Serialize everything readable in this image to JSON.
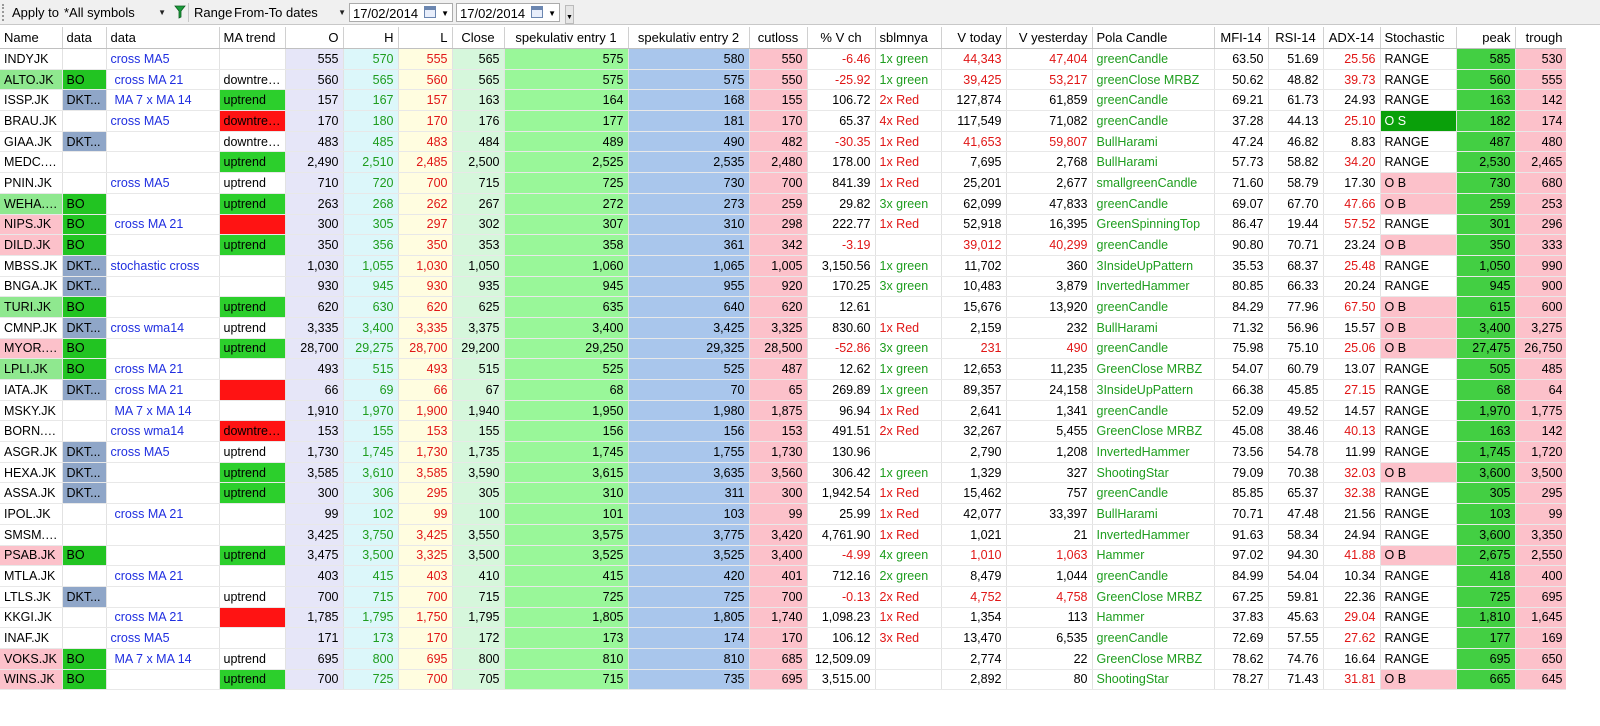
{
  "toolbar": {
    "apply_label": "Apply to",
    "apply_value": "*All symbols",
    "range_label": "Range",
    "range_value": "From-To dates",
    "date_from": "17/02/2014",
    "date_to": "17/02/2014"
  },
  "columns": [
    "Name",
    "data",
    "data",
    "MA trend",
    "O",
    "H",
    "L",
    "Close",
    "spekulativ entry 1",
    "spekulativ entry 2",
    "cutloss",
    "% V ch",
    "sblmnya",
    "V today",
    "V yesterday",
    "Pola Candle",
    "MFI-14",
    "RSI-14",
    "ADX-14",
    "Stochastic",
    "peak",
    "trough"
  ],
  "rows": [
    {
      "name": "INDYJK",
      "d1": "",
      "d2": "cross MA5",
      "ma": "",
      "o": "555",
      "h": "570",
      "l": "555",
      "close": "565",
      "s1": "575",
      "s2": "580",
      "cut": "550",
      "vch": "-6.46",
      "sbl": "1x green",
      "vt": "44,343",
      "vy": "47,404",
      "pola": "greenCandle",
      "mfi": "63.50",
      "rsi": "51.69",
      "adx": "25.56",
      "stoch": "RANGE",
      "peak": "585",
      "trough": "530"
    },
    {
      "name": "ALTO.JK",
      "d1": "BO",
      "d2": "cross MA 21",
      "ma": "downtren...",
      "o": "560",
      "h": "565",
      "l": "560",
      "close": "565",
      "s1": "575",
      "s2": "575",
      "cut": "550",
      "vch": "-25.92",
      "sbl": "1x green",
      "vt": "39,425",
      "vy": "53,217",
      "pola": "greenClose MRBZ",
      "mfi": "50.62",
      "rsi": "48.82",
      "adx": "39.73",
      "stoch": "RANGE",
      "peak": "560",
      "trough": "555"
    },
    {
      "name": "ISSP.JK",
      "d1": "DKT...",
      "d2": "MA 7 x MA 14",
      "ma": "uptrend",
      "o": "157",
      "h": "167",
      "l": "157",
      "close": "163",
      "s1": "164",
      "s2": "168",
      "cut": "155",
      "vch": "106.72",
      "sbl": "2x Red",
      "vt": "127,874",
      "vy": "61,859",
      "pola": "greenCandle",
      "mfi": "69.21",
      "rsi": "61.73",
      "adx": "24.93",
      "stoch": "RANGE",
      "peak": "163",
      "trough": "142"
    },
    {
      "name": "BRAU.JK",
      "d1": "",
      "d2": "cross MA5",
      "ma": "downtren...",
      "o": "170",
      "h": "180",
      "l": "170",
      "close": "176",
      "s1": "177",
      "s2": "181",
      "cut": "170",
      "vch": "65.37",
      "sbl": "4x Red",
      "vt": "117,549",
      "vy": "71,082",
      "pola": "greenCandle",
      "mfi": "37.28",
      "rsi": "44.13",
      "adx": "25.10",
      "stoch": "O S",
      "peak": "182",
      "trough": "174"
    },
    {
      "name": "GIAA.JK",
      "d1": "DKT...",
      "d2": "",
      "ma": "downtren...",
      "o": "483",
      "h": "485",
      "l": "483",
      "close": "484",
      "s1": "489",
      "s2": "490",
      "cut": "482",
      "vch": "-30.35",
      "sbl": "1x Red",
      "vt": "41,653",
      "vy": "59,807",
      "pola": "BullHarami",
      "mfi": "47.24",
      "rsi": "46.82",
      "adx": "8.83",
      "stoch": "RANGE",
      "peak": "487",
      "trough": "480"
    },
    {
      "name": "MEDC.JK",
      "d1": "",
      "d2": "",
      "ma": "uptrend",
      "o": "2,490",
      "h": "2,510",
      "l": "2,485",
      "close": "2,500",
      "s1": "2,525",
      "s2": "2,535",
      "cut": "2,480",
      "vch": "178.00",
      "sbl": "1x Red",
      "vt": "7,695",
      "vy": "2,768",
      "pola": "BullHarami",
      "mfi": "57.73",
      "rsi": "58.82",
      "adx": "34.20",
      "stoch": "RANGE",
      "peak": "2,530",
      "trough": "2,465"
    },
    {
      "name": "PNIN.JK",
      "d1": "",
      "d2": "cross MA5",
      "ma": "uptrend",
      "o": "710",
      "h": "720",
      "l": "700",
      "close": "715",
      "s1": "725",
      "s2": "730",
      "cut": "700",
      "vch": "841.39",
      "sbl": "1x Red",
      "vt": "25,201",
      "vy": "2,677",
      "pola": "smallgreenCandle",
      "mfi": "71.60",
      "rsi": "58.79",
      "adx": "17.30",
      "stoch": "O B",
      "peak": "730",
      "trough": "680"
    },
    {
      "name": "WEHA.JK",
      "d1": "BO",
      "d2": "",
      "ma": "uptrend",
      "o": "263",
      "h": "268",
      "l": "262",
      "close": "267",
      "s1": "272",
      "s2": "273",
      "cut": "259",
      "vch": "29.82",
      "sbl": "3x green",
      "vt": "62,099",
      "vy": "47,833",
      "pola": "greenCandle",
      "mfi": "69.07",
      "rsi": "67.70",
      "adx": "47.66",
      "stoch": "O B",
      "peak": "259",
      "trough": "253"
    },
    {
      "name": "NIPS.JK",
      "d1": "BO",
      "d2": "cross MA 21",
      "ma": "",
      "o": "300",
      "h": "305",
      "l": "297",
      "close": "302",
      "s1": "307",
      "s2": "310",
      "cut": "298",
      "vch": "222.77",
      "sbl": "1x Red",
      "vt": "52,918",
      "vy": "16,395",
      "pola": "GreenSpinningTop",
      "mfi": "86.47",
      "rsi": "19.44",
      "adx": "57.52",
      "stoch": "RANGE",
      "peak": "301",
      "trough": "296"
    },
    {
      "name": "DILD.JK",
      "d1": "BO",
      "d2": "",
      "ma": "uptrend",
      "o": "350",
      "h": "356",
      "l": "350",
      "close": "353",
      "s1": "358",
      "s2": "361",
      "cut": "342",
      "vch": "-3.19",
      "sbl": "",
      "vt": "39,012",
      "vy": "40,299",
      "pola": "greenCandle",
      "mfi": "90.80",
      "rsi": "70.71",
      "adx": "23.24",
      "stoch": "O B",
      "peak": "350",
      "trough": "333"
    },
    {
      "name": "MBSS.JK",
      "d1": "DKT...",
      "d2": "stochastic cross",
      "ma": "",
      "o": "1,030",
      "h": "1,055",
      "l": "1,030",
      "close": "1,050",
      "s1": "1,060",
      "s2": "1,065",
      "cut": "1,005",
      "vch": "3,150.56",
      "sbl": "1x green",
      "vt": "11,702",
      "vy": "360",
      "pola": "3InsideUpPattern",
      "mfi": "35.53",
      "rsi": "68.37",
      "adx": "25.48",
      "stoch": "RANGE",
      "peak": "1,050",
      "trough": "990"
    },
    {
      "name": "BNGA.JK",
      "d1": "DKT...",
      "d2": "",
      "ma": "",
      "o": "930",
      "h": "945",
      "l": "930",
      "close": "935",
      "s1": "945",
      "s2": "955",
      "cut": "920",
      "vch": "170.25",
      "sbl": "3x green",
      "vt": "10,483",
      "vy": "3,879",
      "pola": "InvertedHammer",
      "mfi": "80.85",
      "rsi": "66.33",
      "adx": "20.24",
      "stoch": "RANGE",
      "peak": "945",
      "trough": "900"
    },
    {
      "name": "TURI.JK",
      "d1": "BO",
      "d2": "",
      "ma": "uptrend",
      "o": "620",
      "h": "630",
      "l": "620",
      "close": "625",
      "s1": "635",
      "s2": "640",
      "cut": "620",
      "vch": "12.61",
      "sbl": "",
      "vt": "15,676",
      "vy": "13,920",
      "pola": "greenCandle",
      "mfi": "84.29",
      "rsi": "77.96",
      "adx": "67.50",
      "stoch": "O B",
      "peak": "615",
      "trough": "600"
    },
    {
      "name": "CMNP.JK",
      "d1": "DKT...",
      "d2": "cross wma14",
      "ma": "uptrend",
      "o": "3,335",
      "h": "3,400",
      "l": "3,335",
      "close": "3,375",
      "s1": "3,400",
      "s2": "3,425",
      "cut": "3,325",
      "vch": "830.60",
      "sbl": "1x Red",
      "vt": "2,159",
      "vy": "232",
      "pola": "BullHarami",
      "mfi": "71.32",
      "rsi": "56.96",
      "adx": "15.57",
      "stoch": "O B",
      "peak": "3,400",
      "trough": "3,275"
    },
    {
      "name": "MYOR.JK",
      "d1": "BO",
      "d2": "",
      "ma": "uptrend",
      "o": "28,700",
      "h": "29,275",
      "l": "28,700",
      "close": "29,200",
      "s1": "29,250",
      "s2": "29,325",
      "cut": "28,500",
      "vch": "-52.86",
      "sbl": "3x green",
      "vt": "231",
      "vy": "490",
      "pola": "greenCandle",
      "mfi": "75.98",
      "rsi": "75.10",
      "adx": "25.06",
      "stoch": "O B",
      "peak": "27,475",
      "trough": "26,750"
    },
    {
      "name": "LPLI.JK",
      "d1": "BO",
      "d2": "cross MA 21",
      "ma": "",
      "o": "493",
      "h": "515",
      "l": "493",
      "close": "515",
      "s1": "525",
      "s2": "525",
      "cut": "487",
      "vch": "12.62",
      "sbl": "1x green",
      "vt": "12,653",
      "vy": "11,235",
      "pola": "GreenClose MRBZ",
      "mfi": "54.07",
      "rsi": "60.79",
      "adx": "13.07",
      "stoch": "RANGE",
      "peak": "505",
      "trough": "485"
    },
    {
      "name": "IATA.JK",
      "d1": "DKT...",
      "d2": "cross MA 21",
      "ma": "",
      "o": "66",
      "h": "69",
      "l": "66",
      "close": "67",
      "s1": "68",
      "s2": "70",
      "cut": "65",
      "vch": "269.89",
      "sbl": "1x green",
      "vt": "89,357",
      "vy": "24,158",
      "pola": "3InsideUpPattern",
      "mfi": "66.38",
      "rsi": "45.85",
      "adx": "27.15",
      "stoch": "RANGE",
      "peak": "68",
      "trough": "64"
    },
    {
      "name": "MSKY.JK",
      "d1": "",
      "d2": "MA 7 x MA 14",
      "ma": "",
      "o": "1,910",
      "h": "1,970",
      "l": "1,900",
      "close": "1,940",
      "s1": "1,950",
      "s2": "1,980",
      "cut": "1,875",
      "vch": "96.94",
      "sbl": "1x Red",
      "vt": "2,641",
      "vy": "1,341",
      "pola": "greenCandle",
      "mfi": "52.09",
      "rsi": "49.52",
      "adx": "14.57",
      "stoch": "RANGE",
      "peak": "1,970",
      "trough": "1,775"
    },
    {
      "name": "BORN.JK",
      "d1": "",
      "d2": "cross wma14",
      "ma": "downtren...",
      "o": "153",
      "h": "155",
      "l": "153",
      "close": "155",
      "s1": "156",
      "s2": "156",
      "cut": "153",
      "vch": "491.51",
      "sbl": "2x Red",
      "vt": "32,267",
      "vy": "5,455",
      "pola": "GreenClose MRBZ",
      "mfi": "45.08",
      "rsi": "38.46",
      "adx": "40.13",
      "stoch": "RANGE",
      "peak": "163",
      "trough": "142"
    },
    {
      "name": "ASGR.JK",
      "d1": "DKT...",
      "d2": "cross MA5",
      "ma": "uptrend",
      "o": "1,730",
      "h": "1,745",
      "l": "1,730",
      "close": "1,735",
      "s1": "1,745",
      "s2": "1,755",
      "cut": "1,730",
      "vch": "130.96",
      "sbl": "",
      "vt": "2,790",
      "vy": "1,208",
      "pola": "InvertedHammer",
      "mfi": "73.56",
      "rsi": "54.78",
      "adx": "11.99",
      "stoch": "RANGE",
      "peak": "1,745",
      "trough": "1,720"
    },
    {
      "name": "HEXA.JK",
      "d1": "DKT...",
      "d2": "",
      "ma": "uptrend",
      "o": "3,585",
      "h": "3,610",
      "l": "3,585",
      "close": "3,590",
      "s1": "3,615",
      "s2": "3,635",
      "cut": "3,560",
      "vch": "306.42",
      "sbl": "1x green",
      "vt": "1,329",
      "vy": "327",
      "pola": "ShootingStar",
      "mfi": "79.09",
      "rsi": "70.38",
      "adx": "32.03",
      "stoch": "O B",
      "peak": "3,600",
      "trough": "3,500"
    },
    {
      "name": "ASSA.JK",
      "d1": "DKT...",
      "d2": "",
      "ma": "uptrend",
      "o": "300",
      "h": "306",
      "l": "295",
      "close": "305",
      "s1": "310",
      "s2": "311",
      "cut": "300",
      "vch": "1,942.54",
      "sbl": "1x Red",
      "vt": "15,462",
      "vy": "757",
      "pola": "greenCandle",
      "mfi": "85.85",
      "rsi": "65.37",
      "adx": "32.38",
      "stoch": "RANGE",
      "peak": "305",
      "trough": "295"
    },
    {
      "name": "IPOL.JK",
      "d1": "",
      "d2": "cross MA 21",
      "ma": "",
      "o": "99",
      "h": "102",
      "l": "99",
      "close": "100",
      "s1": "101",
      "s2": "103",
      "cut": "99",
      "vch": "25.99",
      "sbl": "1x Red",
      "vt": "42,077",
      "vy": "33,397",
      "pola": "BullHarami",
      "mfi": "70.71",
      "rsi": "47.48",
      "adx": "21.56",
      "stoch": "RANGE",
      "peak": "103",
      "trough": "99"
    },
    {
      "name": "SMSM.JK",
      "d1": "",
      "d2": "",
      "ma": "",
      "o": "3,425",
      "h": "3,750",
      "l": "3,425",
      "close": "3,550",
      "s1": "3,575",
      "s2": "3,775",
      "cut": "3,420",
      "vch": "4,761.90",
      "sbl": "1x Red",
      "vt": "1,021",
      "vy": "21",
      "pola": "InvertedHammer",
      "mfi": "91.63",
      "rsi": "58.34",
      "adx": "24.94",
      "stoch": "RANGE",
      "peak": "3,600",
      "trough": "3,350"
    },
    {
      "name": "PSAB.JK",
      "d1": "BO",
      "d2": "",
      "ma": "uptrend",
      "o": "3,475",
      "h": "3,500",
      "l": "3,325",
      "close": "3,500",
      "s1": "3,525",
      "s2": "3,525",
      "cut": "3,400",
      "vch": "-4.99",
      "sbl": "4x green",
      "vt": "1,010",
      "vy": "1,063",
      "pola": "Hammer",
      "mfi": "97.02",
      "rsi": "94.30",
      "adx": "41.88",
      "stoch": "O B",
      "peak": "2,675",
      "trough": "2,550"
    },
    {
      "name": "MTLA.JK",
      "d1": "",
      "d2": "cross MA 21",
      "ma": "",
      "o": "403",
      "h": "415",
      "l": "403",
      "close": "410",
      "s1": "415",
      "s2": "420",
      "cut": "401",
      "vch": "712.16",
      "sbl": "2x green",
      "vt": "8,479",
      "vy": "1,044",
      "pola": "greenCandle",
      "mfi": "84.99",
      "rsi": "54.04",
      "adx": "10.34",
      "stoch": "RANGE",
      "peak": "418",
      "trough": "400"
    },
    {
      "name": "LTLS.JK",
      "d1": "DKT...",
      "d2": "",
      "ma": "uptrend",
      "o": "700",
      "h": "715",
      "l": "700",
      "close": "715",
      "s1": "725",
      "s2": "725",
      "cut": "700",
      "vch": "-0.13",
      "sbl": "2x Red",
      "vt": "4,752",
      "vy": "4,758",
      "pola": "GreenClose MRBZ",
      "mfi": "67.25",
      "rsi": "59.81",
      "adx": "22.36",
      "stoch": "RANGE",
      "peak": "725",
      "trough": "695"
    },
    {
      "name": "KKGI.JK",
      "d1": "",
      "d2": "cross MA 21",
      "ma": "",
      "o": "1,785",
      "h": "1,795",
      "l": "1,750",
      "close": "1,795",
      "s1": "1,805",
      "s2": "1,805",
      "cut": "1,740",
      "vch": "1,098.23",
      "sbl": "1x Red",
      "vt": "1,354",
      "vy": "113",
      "pola": "Hammer",
      "mfi": "37.83",
      "rsi": "45.63",
      "adx": "29.04",
      "stoch": "RANGE",
      "peak": "1,810",
      "trough": "1,645"
    },
    {
      "name": "INAF.JK",
      "d1": "",
      "d2": "cross MA5",
      "ma": "",
      "o": "171",
      "h": "173",
      "l": "170",
      "close": "172",
      "s1": "173",
      "s2": "174",
      "cut": "170",
      "vch": "106.12",
      "sbl": "3x Red",
      "vt": "13,470",
      "vy": "6,535",
      "pola": "greenCandle",
      "mfi": "72.69",
      "rsi": "57.55",
      "adx": "27.62",
      "stoch": "RANGE",
      "peak": "177",
      "trough": "169"
    },
    {
      "name": "VOKS.JK",
      "d1": "BO",
      "d2": "MA 7 x MA 14",
      "ma": "uptrend",
      "o": "695",
      "h": "800",
      "l": "695",
      "close": "800",
      "s1": "810",
      "s2": "810",
      "cut": "685",
      "vch": "12,509.09",
      "sbl": "",
      "vt": "2,774",
      "vy": "22",
      "pola": "GreenClose MRBZ",
      "mfi": "78.62",
      "rsi": "74.76",
      "adx": "16.64",
      "stoch": "RANGE",
      "peak": "695",
      "trough": "650"
    },
    {
      "name": "WINS.JK",
      "d1": "BO",
      "d2": "",
      "ma": "uptrend",
      "o": "700",
      "h": "725",
      "l": "700",
      "close": "705",
      "s1": "715",
      "s2": "735",
      "cut": "695",
      "vch": "3,515.00",
      "sbl": "",
      "vt": "2,892",
      "vy": "80",
      "pola": "ShootingStar",
      "mfi": "78.27",
      "rsi": "71.43",
      "adx": "31.81",
      "stoch": "O B",
      "peak": "665",
      "trough": "645"
    }
  ]
}
